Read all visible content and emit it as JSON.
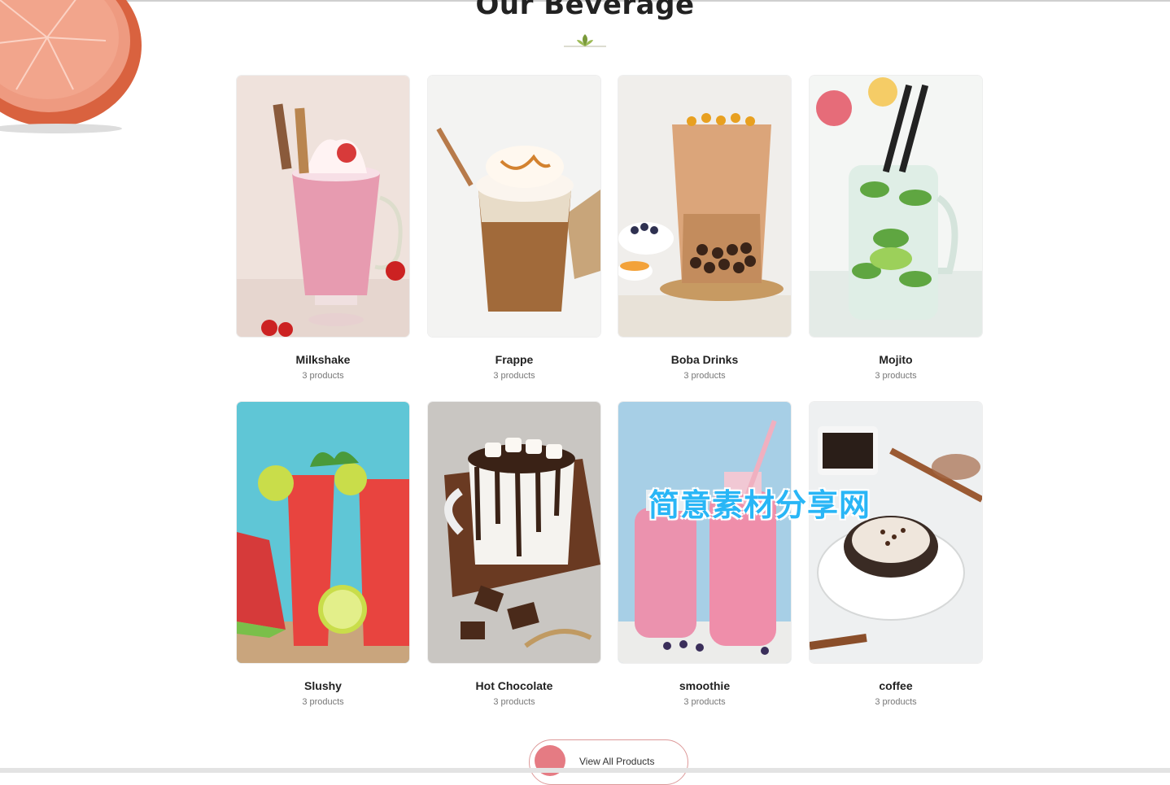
{
  "section": {
    "title": "Our Beverage"
  },
  "categories": [
    {
      "name": "Milkshake",
      "count": "3 products",
      "image": "milkshake-photo"
    },
    {
      "name": "Frappe",
      "count": "3 products",
      "image": "frappe-photo"
    },
    {
      "name": "Boba Drinks",
      "count": "3 products",
      "image": "boba-photo"
    },
    {
      "name": "Mojito",
      "count": "3 products",
      "image": "mojito-photo"
    },
    {
      "name": "Slushy",
      "count": "3 products",
      "image": "slushy-photo"
    },
    {
      "name": "Hot Chocolate",
      "count": "3 products",
      "image": "hot-chocolate-photo"
    },
    {
      "name": "smoothie",
      "count": "3 products",
      "image": "smoothie-photo"
    },
    {
      "name": "coffee",
      "count": "3 products",
      "image": "coffee-photo"
    }
  ],
  "watermark": "简意素材分享网",
  "cta": {
    "label": "View All Products"
  },
  "colors": {
    "accent": "#e57b83",
    "watermark": "#29b6f6"
  }
}
